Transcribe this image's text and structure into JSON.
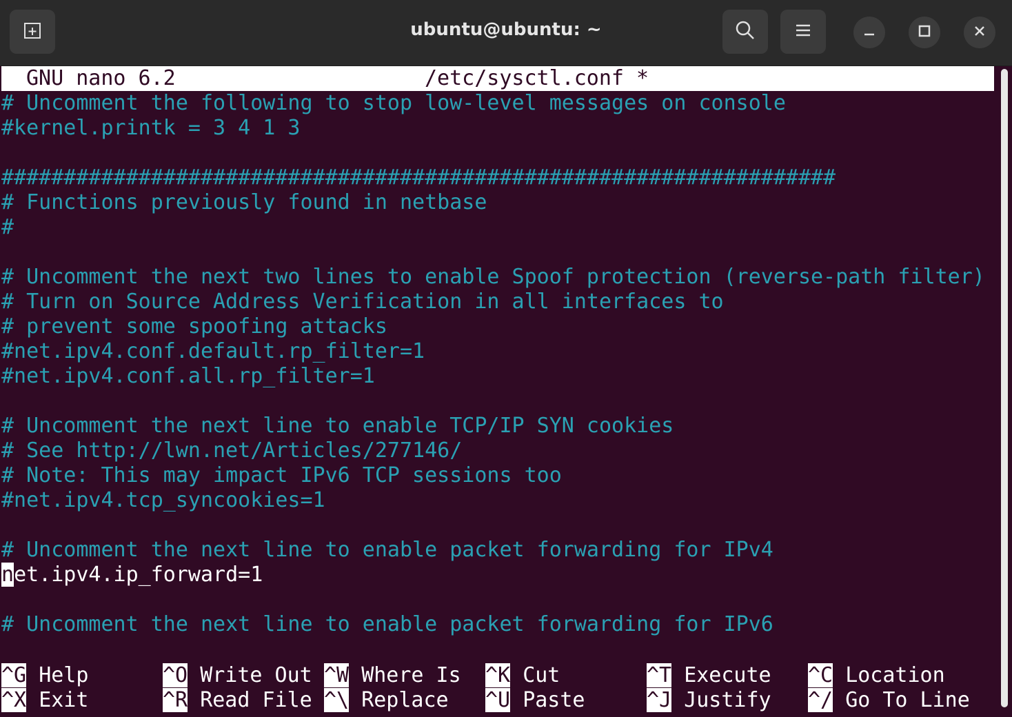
{
  "window": {
    "title": "ubuntu@ubuntu: ~",
    "new_tab_icon": "new-tab-icon",
    "search_icon": "search-icon",
    "menu_icon": "hamburger-menu-icon",
    "minimize_icon": "minimize-icon",
    "maximize_icon": "maximize-icon",
    "close_icon": "close-icon"
  },
  "nano": {
    "version": "GNU nano 6.2",
    "filename": "/etc/sysctl.conf *",
    "lines": [
      "# Uncomment the following to stop low-level messages on console",
      "#kernel.printk = 3 4 1 3",
      "",
      "###################################################################",
      "# Functions previously found in netbase",
      "#",
      "",
      "# Uncomment the next two lines to enable Spoof protection (reverse-path filter)",
      "# Turn on Source Address Verification in all interfaces to",
      "# prevent some spoofing attacks",
      "#net.ipv4.conf.default.rp_filter=1",
      "#net.ipv4.conf.all.rp_filter=1",
      "",
      "# Uncomment the next line to enable TCP/IP SYN cookies",
      "# See http://lwn.net/Articles/277146/",
      "# Note: This may impact IPv6 TCP sessions too",
      "#net.ipv4.tcp_syncookies=1",
      "",
      "# Uncomment the next line to enable packet forwarding for IPv4",
      "net.ipv4.ip_forward=1",
      "",
      "# Uncomment the next line to enable packet forwarding for IPv6"
    ],
    "cursor_line_first_char": "n",
    "cursor_line_rest": "et.ipv4.ip_forward=1",
    "shortcuts": [
      {
        "key": "^G",
        "label": "Help"
      },
      {
        "key": "^O",
        "label": "Write Out"
      },
      {
        "key": "^W",
        "label": "Where Is"
      },
      {
        "key": "^K",
        "label": "Cut"
      },
      {
        "key": "^T",
        "label": "Execute"
      },
      {
        "key": "^C",
        "label": "Location"
      },
      {
        "key": "^X",
        "label": "Exit"
      },
      {
        "key": "^R",
        "label": "Read File"
      },
      {
        "key": "^\\",
        "label": "Replace"
      },
      {
        "key": "^U",
        "label": "Paste"
      },
      {
        "key": "^J",
        "label": "Justify"
      },
      {
        "key": "^/",
        "label": "Go To Line"
      }
    ]
  },
  "colors": {
    "background": "#300a24",
    "comment": "#2aa1b3",
    "text": "#ffffff"
  }
}
